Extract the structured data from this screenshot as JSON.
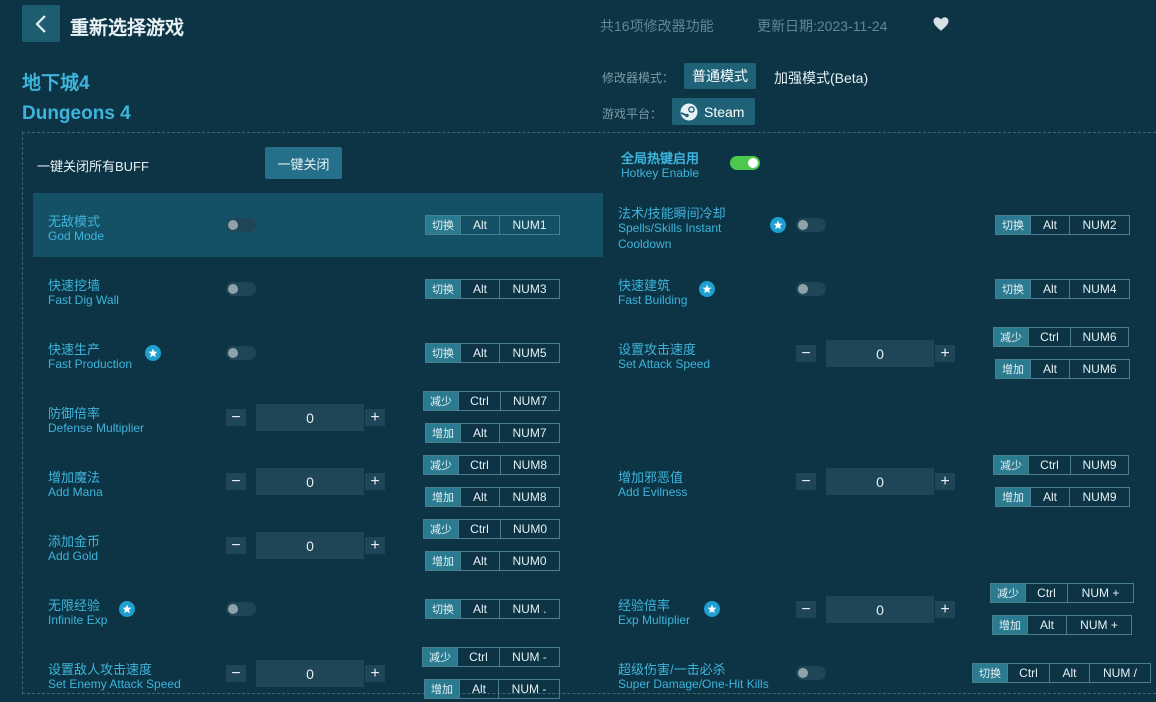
{
  "header": {
    "back_icon": "chevron-left-icon",
    "title": "重新选择游戏",
    "feature_count": "共16项修改器功能",
    "update_date": "更新日期:2023-11-24",
    "favorite_icon": "heart-icon"
  },
  "game": {
    "name_cn": "地下城4",
    "name_en": "Dungeons 4"
  },
  "mode": {
    "label": "修改器模式：",
    "normal": "普通模式",
    "beta": "加强模式(Beta)"
  },
  "platform": {
    "label": "游戏平台：",
    "name": "Steam",
    "icon": "steam-icon"
  },
  "top_row": {
    "close_all_label": "一键关闭所有BUFF",
    "close_all_button": "一键关闭",
    "global_hotkey_cn": "全局热键启用",
    "global_hotkey_en": "Hotkey Enable",
    "global_hotkey_on": true
  },
  "colors": {
    "accent": "#3eb4dc",
    "background": "#0c3444",
    "toggle_on": "#4cc94e",
    "button": "#1f6277"
  },
  "cheats": [
    {
      "cn": "无敌模式",
      "en": "God Mode",
      "hk": [
        "切换",
        "Alt",
        "NUM1"
      ]
    },
    {
      "cn": "法术/技能瞬间冷却",
      "en1": "Spells/Skills Instant",
      "en2": "Cooldown",
      "hk": [
        "切换",
        "Alt",
        "NUM2"
      ]
    },
    {
      "cn": "快速挖墙",
      "en": "Fast Dig Wall",
      "hk": [
        "切换",
        "Alt",
        "NUM3"
      ]
    },
    {
      "cn": "快速建筑",
      "en": "Fast Building",
      "hk": [
        "切换",
        "Alt",
        "NUM4"
      ]
    },
    {
      "cn": "快速生产",
      "en": "Fast Production",
      "hk": [
        "切换",
        "Alt",
        "NUM5"
      ]
    },
    {
      "cn": "设置攻击速度",
      "en": "Set Attack Speed",
      "value": "0",
      "hk_dec": [
        "减少",
        "Ctrl",
        "NUM6"
      ],
      "hk_inc": [
        "增加",
        "Alt",
        "NUM6"
      ]
    },
    {
      "cn": "防御倍率",
      "en": "Defense Multiplier",
      "value": "0",
      "hk_dec": [
        "减少",
        "Ctrl",
        "NUM7"
      ],
      "hk_inc": [
        "增加",
        "Alt",
        "NUM7"
      ]
    },
    {
      "cn": "增加魔法",
      "en": "Add Mana",
      "value": "0",
      "hk_dec": [
        "减少",
        "Ctrl",
        "NUM8"
      ],
      "hk_inc": [
        "增加",
        "Alt",
        "NUM8"
      ]
    },
    {
      "cn": "增加邪恶值",
      "en": "Add Evilness",
      "value": "0",
      "hk_dec": [
        "减少",
        "Ctrl",
        "NUM9"
      ],
      "hk_inc": [
        "增加",
        "Alt",
        "NUM9"
      ]
    },
    {
      "cn": "添加金币",
      "en": "Add Gold",
      "value": "0",
      "hk_dec": [
        "减少",
        "Ctrl",
        "NUM0"
      ],
      "hk_inc": [
        "增加",
        "Alt",
        "NUM0"
      ]
    },
    {
      "cn": "无限经验",
      "en": "Infinite Exp",
      "hk": [
        "切换",
        "Alt",
        "NUM ."
      ]
    },
    {
      "cn": "经验倍率",
      "en": "Exp Multiplier",
      "value": "0",
      "hk_dec": [
        "减少",
        "Ctrl",
        "NUM +"
      ],
      "hk_inc": [
        "增加",
        "Alt",
        "NUM +"
      ]
    },
    {
      "cn": "设置敌人攻击速度",
      "en": "Set Enemy Attack Speed",
      "value": "0",
      "hk_dec": [
        "减少",
        "Ctrl",
        "NUM -"
      ],
      "hk_inc": [
        "增加",
        "Alt",
        "NUM -"
      ]
    },
    {
      "cn": "超级伤害/一击必杀",
      "en": "Super Damage/One-Hit Kills",
      "hk": [
        "切换",
        "Ctrl",
        "Alt",
        "NUM /"
      ]
    }
  ],
  "stepper_symbols": {
    "minus": "−",
    "plus": "+"
  }
}
